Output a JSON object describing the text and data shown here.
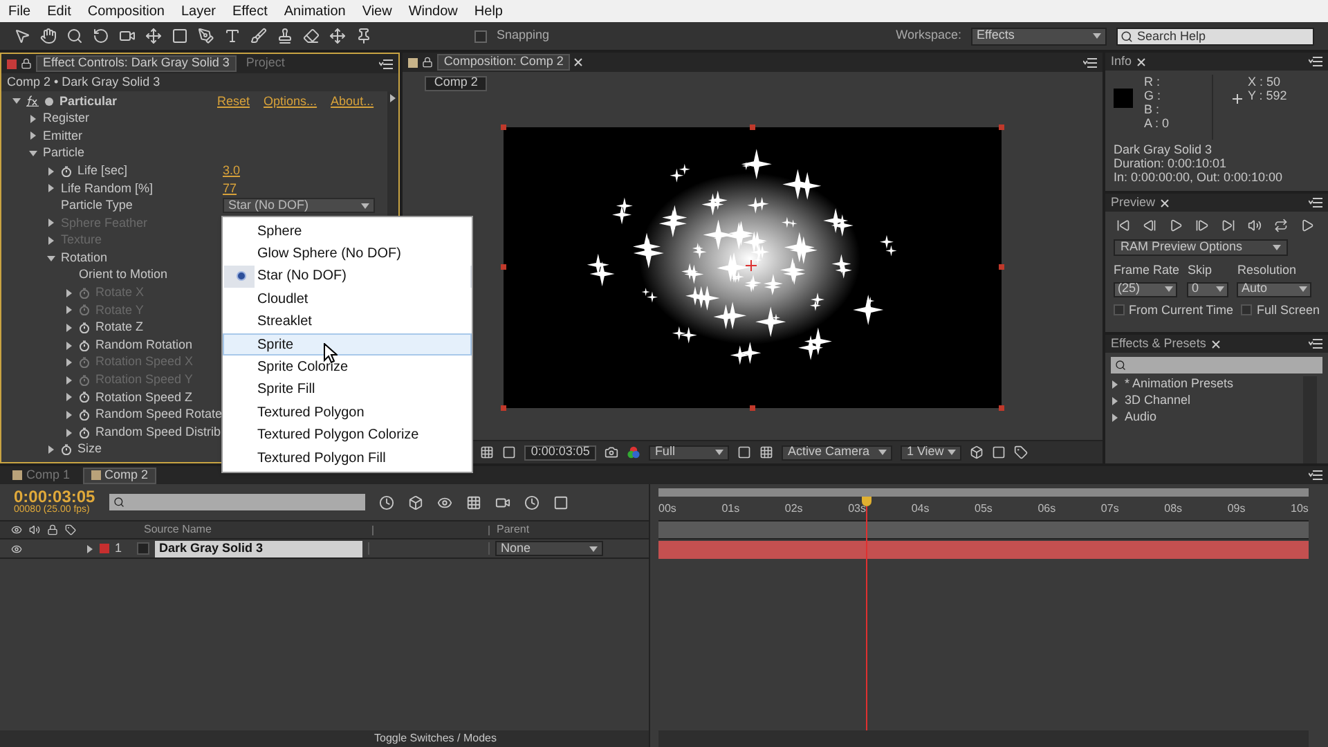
{
  "menu": [
    "File",
    "Edit",
    "Composition",
    "Layer",
    "Effect",
    "Animation",
    "View",
    "Window",
    "Help"
  ],
  "toolbar": {
    "snapping": {
      "label": "Snapping",
      "checked": false
    },
    "workspace_label": "Workspace:",
    "workspace": "Effects",
    "search_placeholder": "Search Help"
  },
  "effect_controls": {
    "tabs": [
      {
        "label": "Effect Controls: Dark Gray Solid 3",
        "selected": true
      },
      {
        "label": "Project",
        "selected": false
      }
    ],
    "breadcrumb": "Comp 2 • Dark Gray Solid 3",
    "effect": {
      "name": "Particular",
      "expanded": true,
      "links": [
        "Reset",
        "Options...",
        "About..."
      ],
      "items": [
        {
          "label": "Register",
          "kind": "group",
          "expanded": false,
          "stopwatch": false,
          "disabled": false
        },
        {
          "label": "Emitter",
          "kind": "group",
          "expanded": false,
          "stopwatch": false,
          "disabled": false
        },
        {
          "label": "Particle",
          "kind": "group",
          "expanded": true,
          "stopwatch": false,
          "disabled": false,
          "children": [
            {
              "label": "Life [sec]",
              "kind": "group",
              "expanded": false,
              "stopwatch": true,
              "disabled": false,
              "value": "3.0"
            },
            {
              "label": "Life Random [%]",
              "kind": "group",
              "expanded": false,
              "stopwatch": false,
              "disabled": false,
              "value": "77"
            },
            {
              "label": "Particle Type",
              "kind": "dropdown",
              "stopwatch": false,
              "disabled": false,
              "value": "Star (No DOF)"
            },
            {
              "label": "Sphere Feather",
              "kind": "group",
              "expanded": false,
              "stopwatch": false,
              "disabled": true
            },
            {
              "label": "Texture",
              "kind": "group",
              "expanded": false,
              "stopwatch": false,
              "disabled": true
            },
            {
              "label": "Rotation",
              "kind": "group",
              "expanded": true,
              "stopwatch": false,
              "disabled": false,
              "children": [
                {
                  "label": "Orient to Motion",
                  "kind": "plain",
                  "stopwatch": false,
                  "disabled": false
                },
                {
                  "label": "Rotate X",
                  "kind": "group",
                  "expanded": false,
                  "stopwatch": true,
                  "disabled": true
                },
                {
                  "label": "Rotate Y",
                  "kind": "group",
                  "expanded": false,
                  "stopwatch": true,
                  "disabled": true
                },
                {
                  "label": "Rotate Z",
                  "kind": "group",
                  "expanded": false,
                  "stopwatch": true,
                  "disabled": false
                },
                {
                  "label": "Random Rotation",
                  "kind": "group",
                  "expanded": false,
                  "stopwatch": true,
                  "disabled": false
                },
                {
                  "label": "Rotation Speed X",
                  "kind": "group",
                  "expanded": false,
                  "stopwatch": true,
                  "disabled": true
                },
                {
                  "label": "Rotation Speed Y",
                  "kind": "group",
                  "expanded": false,
                  "stopwatch": true,
                  "disabled": true
                },
                {
                  "label": "Rotation Speed Z",
                  "kind": "group",
                  "expanded": false,
                  "stopwatch": true,
                  "disabled": false
                },
                {
                  "label": "Random Speed Rotate",
                  "kind": "group",
                  "expanded": false,
                  "stopwatch": true,
                  "disabled": false
                },
                {
                  "label": "Random Speed Distrib",
                  "kind": "group",
                  "expanded": false,
                  "stopwatch": true,
                  "disabled": false
                }
              ]
            },
            {
              "label": "Size",
              "kind": "group",
              "expanded": false,
              "stopwatch": true,
              "disabled": false
            }
          ]
        }
      ]
    }
  },
  "dropdown": {
    "options": [
      {
        "label": "Sphere",
        "selected": false,
        "hovered": false
      },
      {
        "label": "Glow Sphere (No DOF)",
        "selected": false,
        "hovered": false
      },
      {
        "label": "Star (No DOF)",
        "selected": true,
        "hovered": false
      },
      {
        "label": "Cloudlet",
        "selected": false,
        "hovered": false
      },
      {
        "label": "Streaklet",
        "selected": false,
        "hovered": false
      },
      {
        "label": "Sprite",
        "selected": false,
        "hovered": true
      },
      {
        "label": "Sprite Colorize",
        "selected": false,
        "hovered": false
      },
      {
        "label": "Sprite Fill",
        "selected": false,
        "hovered": false
      },
      {
        "label": "Textured Polygon",
        "selected": false,
        "hovered": false
      },
      {
        "label": "Textured Polygon Colorize",
        "selected": false,
        "hovered": false
      },
      {
        "label": "Textured Polygon Fill",
        "selected": false,
        "hovered": false
      }
    ]
  },
  "composition": {
    "tab": "Composition: Comp 2",
    "breadcrumb": "Comp 2",
    "bar": {
      "timecode": "0:00:03:05",
      "resolution": "Full",
      "camera": "Active Camera",
      "views": "1 View"
    }
  },
  "info": {
    "title": "Info",
    "channels": [
      "R :",
      "G :",
      "B :",
      "A : 0"
    ],
    "x": "X : 50",
    "y": "Y : 592",
    "lines": [
      "Dark Gray Solid 3",
      "Duration: 0:00:10:01",
      "In: 0:00:00:00, Out: 0:00:10:00"
    ]
  },
  "preview": {
    "title": "Preview",
    "options": "RAM Preview Options",
    "fields": [
      {
        "label": "Frame Rate",
        "value": "(25)"
      },
      {
        "label": "Skip",
        "value": "0"
      },
      {
        "label": "Resolution",
        "value": "Auto"
      }
    ],
    "checks": [
      {
        "label": "From Current Time",
        "checked": false
      },
      {
        "label": "Full Screen",
        "checked": false
      }
    ]
  },
  "effects_presets": {
    "title": "Effects & Presets",
    "items": [
      "* Animation Presets",
      "3D Channel",
      "Audio"
    ]
  },
  "timeline": {
    "tabs": [
      {
        "label": "Comp 1",
        "selected": false
      },
      {
        "label": "Comp 2",
        "selected": true
      }
    ],
    "timecode": "0:00:03:05",
    "frame_info": "00080 (25.00 fps)",
    "ruler": [
      "00s",
      "01s",
      "02s",
      "03s",
      "04s",
      "05s",
      "06s",
      "07s",
      "08s",
      "09s",
      "10s"
    ],
    "columns": [
      "Source Name",
      "Parent"
    ],
    "layers": [
      {
        "number": "1",
        "name": "Dark Gray Solid 3",
        "parent": "None",
        "selected": true,
        "color": "#c62f2f"
      }
    ],
    "footer": "Toggle Switches / Modes"
  }
}
